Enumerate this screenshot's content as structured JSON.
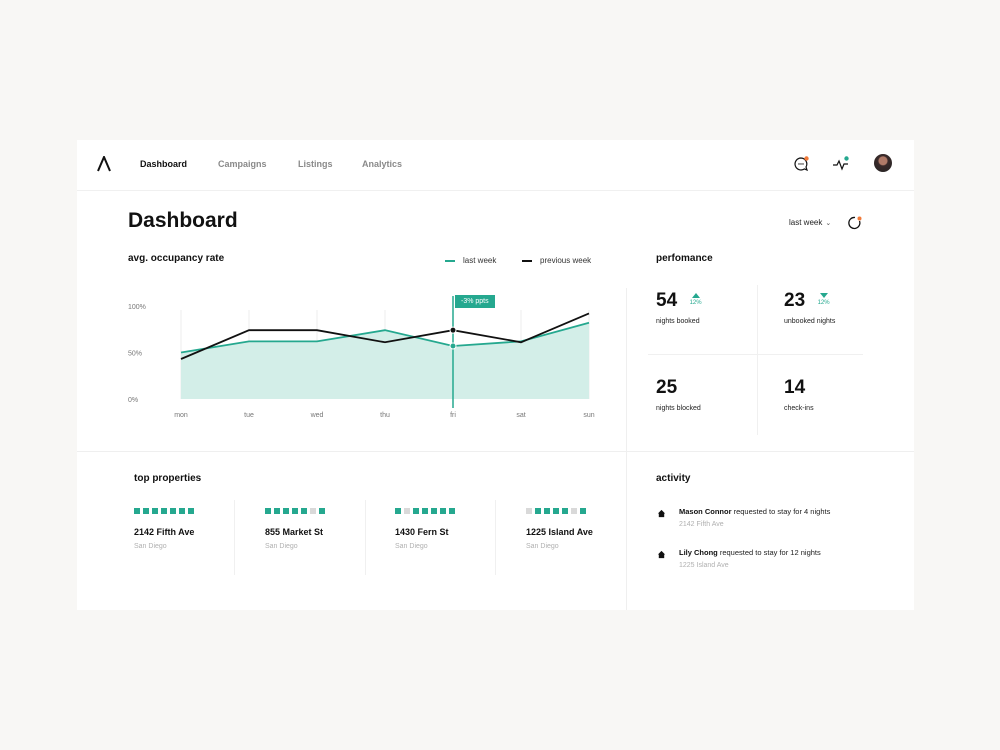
{
  "nav": {
    "items": [
      {
        "label": "Dashboard",
        "active": true
      },
      {
        "label": "Campaigns",
        "active": false
      },
      {
        "label": "Listings",
        "active": false
      },
      {
        "label": "Analytics",
        "active": false
      }
    ],
    "icons": [
      "logo-icon",
      "chat-icon",
      "activity-icon",
      "avatar"
    ]
  },
  "page": {
    "title": "Dashboard",
    "period": "last week"
  },
  "occupancy": {
    "title": "avg. occupancy rate",
    "legend": [
      {
        "label": "last week",
        "color": "#25a88f"
      },
      {
        "label": "previous week",
        "color": "#111111"
      }
    ],
    "tooltip": "-3% ppts"
  },
  "chart_data": {
    "type": "line",
    "categories": [
      "mon",
      "tue",
      "wed",
      "thu",
      "fri",
      "sat",
      "sun"
    ],
    "y_ticks": [
      "100%",
      "50%",
      "0%"
    ],
    "ylim": [
      0,
      100
    ],
    "series": [
      {
        "name": "last week",
        "values": [
          50,
          62,
          62,
          74,
          57,
          62,
          82
        ],
        "color": "#25a88f",
        "area": true
      },
      {
        "name": "previous week",
        "values": [
          43,
          74,
          74,
          61,
          74,
          61,
          92
        ],
        "color": "#111111",
        "area": false
      }
    ],
    "highlight_category": "fri",
    "grid": false,
    "legend_position": "top-right"
  },
  "performance": {
    "title": "perfomance",
    "cells": [
      {
        "value": "54",
        "label": "nights booked",
        "trend": "up",
        "change": "12%"
      },
      {
        "value": "23",
        "label": "unbooked nights",
        "trend": "down",
        "change": "12%"
      },
      {
        "value": "25",
        "label": "nights blocked"
      },
      {
        "value": "14",
        "label": "check-ins"
      }
    ]
  },
  "properties": {
    "title": "top properties",
    "items": [
      {
        "name": "2142 Fifth Ave",
        "city": "San Diego",
        "availability": [
          1,
          1,
          1,
          1,
          1,
          1,
          1
        ]
      },
      {
        "name": "855 Market St",
        "city": "San Diego",
        "availability": [
          1,
          1,
          1,
          1,
          1,
          0,
          1
        ]
      },
      {
        "name": "1430 Fern St",
        "city": "San Diego",
        "availability": [
          1,
          0,
          1,
          1,
          1,
          1,
          1
        ]
      },
      {
        "name": "1225 Island Ave",
        "city": "San Diego",
        "availability": [
          0,
          1,
          1,
          1,
          1,
          0,
          1
        ]
      }
    ],
    "colors": {
      "booked": "#25a88f",
      "open": "#d9d9d9"
    }
  },
  "activity": {
    "title": "activity",
    "items": [
      {
        "name": "Mason Connor",
        "text": "requested to stay for 4 nights",
        "property": "2142 Fifth Ave"
      },
      {
        "name": "Lily Chong",
        "text": "requested to stay for 12 nights",
        "property": "1225 Island Ave"
      }
    ]
  },
  "colors": {
    "accent": "#25a88f",
    "notify": "#f07a3a",
    "online": "#25a88f"
  }
}
